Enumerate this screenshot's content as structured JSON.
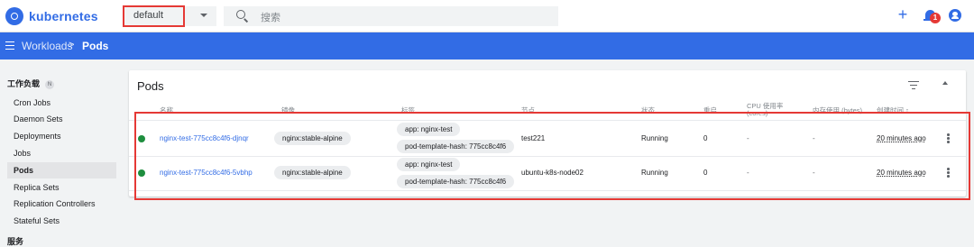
{
  "app": {
    "logo_text": "kubernetes",
    "accent_color": "#326ce5"
  },
  "topbar": {
    "namespace_value": "default",
    "search_placeholder": "搜索",
    "plus_label": "+",
    "notification_count": "1"
  },
  "breadcrumb": {
    "parent": "Workloads",
    "separator": ">",
    "current": "Pods"
  },
  "sidebar": {
    "section_title": "工作负载",
    "section_badge": "N",
    "items": [
      {
        "label": "Cron Jobs"
      },
      {
        "label": "Daemon Sets"
      },
      {
        "label": "Deployments"
      },
      {
        "label": "Jobs"
      },
      {
        "label": "Pods",
        "active": true
      },
      {
        "label": "Replica Sets"
      },
      {
        "label": "Replication Controllers"
      },
      {
        "label": "Stateful Sets"
      }
    ],
    "section2_title": "服务"
  },
  "pods_card": {
    "title": "Pods",
    "columns": {
      "name": "名称",
      "image": "镜像",
      "labels": "标签",
      "node": "节点",
      "status": "状态",
      "restarts": "重启",
      "cpu_line1": "CPU 使用率",
      "cpu_line2": "(cores)",
      "memory": "内存使用 (bytes)",
      "created": "创建时间 ↑"
    },
    "rows": [
      {
        "name": "nginx-test-775cc8c4f6-djnqr",
        "image": "nginx:stable-alpine",
        "label1": "app: nginx-test",
        "label2": "pod-template-hash: 775cc8c4f6",
        "node": "test221",
        "status": "Running",
        "restarts": "0",
        "cpu": "-",
        "memory": "-",
        "created": "20 minutes ago"
      },
      {
        "name": "nginx-test-775cc8c4f6-5vbhp",
        "image": "nginx:stable-alpine",
        "label1": "app: nginx-test",
        "label2": "pod-template-hash: 775cc8c4f6",
        "node": "ubuntu-k8s-node02",
        "status": "Running",
        "restarts": "0",
        "cpu": "-",
        "memory": "-",
        "created": "20 minutes ago"
      }
    ]
  }
}
